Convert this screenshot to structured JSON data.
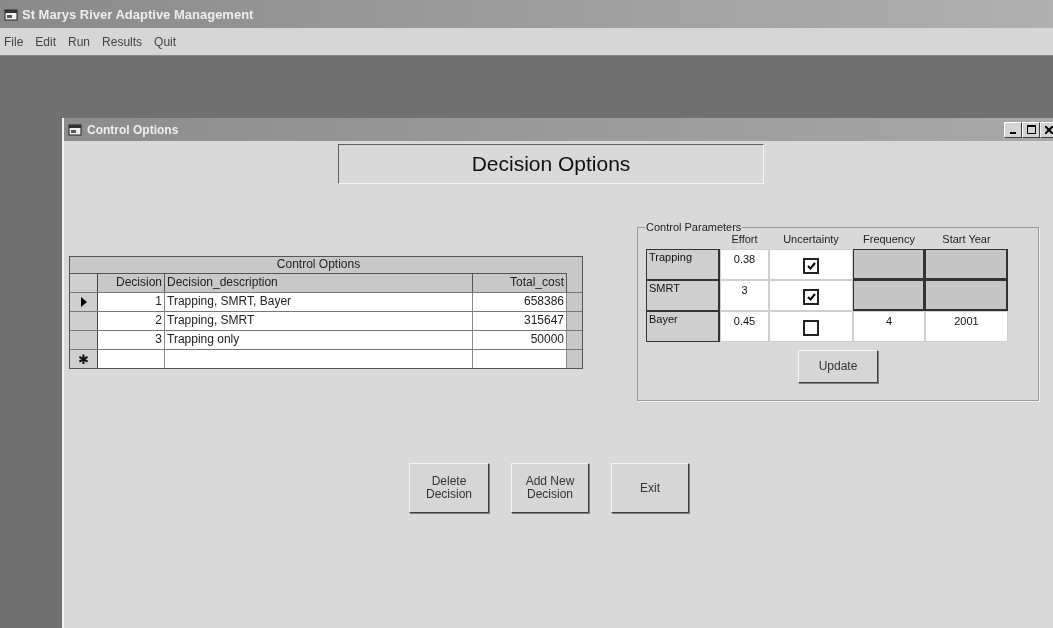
{
  "window": {
    "title": "St Marys River Adaptive Management"
  },
  "menu": [
    "File",
    "Edit",
    "Run",
    "Results",
    "Quit"
  ],
  "child_window": {
    "title": "Control Options"
  },
  "heading": "Decision Options",
  "grid": {
    "caption": "Control Options",
    "columns": [
      "Decision",
      "Decision_description",
      "Total_cost"
    ],
    "rows": [
      {
        "selected": true,
        "cells": [
          "1",
          "Trapping, SMRT, Bayer",
          "658386"
        ]
      },
      {
        "selected": false,
        "cells": [
          "2",
          "Trapping, SMRT",
          "315647"
        ]
      },
      {
        "selected": false,
        "cells": [
          "3",
          "Trapping only",
          "50000"
        ]
      }
    ],
    "new_row_marker": "✱"
  },
  "parameters": {
    "title": "Control Parameters",
    "columns": [
      "Effort",
      "Uncertainty",
      "Frequency",
      "Start Year"
    ],
    "rows": [
      {
        "label": "Trapping",
        "effort": "0.38",
        "uncertainty": true,
        "schedule_enabled": false
      },
      {
        "label": "SMRT",
        "effort": "3",
        "uncertainty": true,
        "schedule_enabled": false
      },
      {
        "label": "Bayer",
        "effort": "0.45",
        "uncertainty": false,
        "schedule_enabled": true,
        "frequency": "4",
        "start_year": "2001"
      }
    ],
    "button": "Update"
  },
  "buttons": [
    "Delete Decision",
    "Add New Decision",
    "Exit"
  ]
}
